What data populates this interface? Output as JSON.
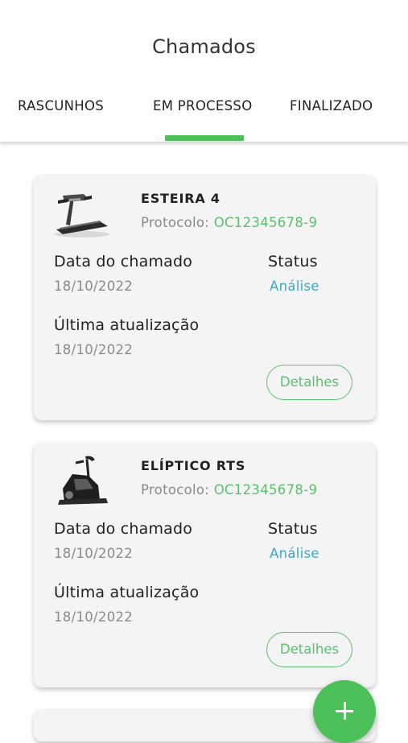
{
  "header": {
    "title": "Chamados"
  },
  "tabs": [
    {
      "label": "RASCUNHOS"
    },
    {
      "label": "EM PROCESSO",
      "active": true
    },
    {
      "label": "FINALIZADO"
    }
  ],
  "accent_color": "#4cc15a",
  "status_color": "#3ea7c9",
  "cards": [
    {
      "equipment": "ESTEIRA 4",
      "icon": "treadmill-icon",
      "protocol_label": "Protocolo: ",
      "protocol_code": "OC12345678-9",
      "date_label": "Data do chamado",
      "date_value": "18/10/2022",
      "status_label": "Status",
      "status_value": "Análise",
      "update_label": "Última atualização",
      "update_value": "18/10/2022",
      "details_label": "Detalhes"
    },
    {
      "equipment": "ELÍPTICO RTS",
      "icon": "elliptical-icon",
      "protocol_label": "Protocolo: ",
      "protocol_code": "OC12345678-9",
      "date_label": "Data do chamado",
      "date_value": "18/10/2022",
      "status_label": "Status",
      "status_value": "Análise",
      "update_label": "Última atualização",
      "update_value": "18/10/2022",
      "details_label": "Detalhes"
    }
  ],
  "fab": {
    "icon": "plus-icon"
  }
}
